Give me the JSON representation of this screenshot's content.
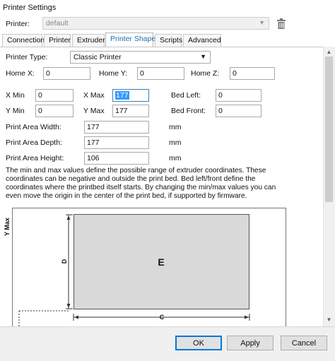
{
  "window": {
    "title": "Printer Settings"
  },
  "printer": {
    "label": "Printer:",
    "value": "default"
  },
  "tabs": [
    {
      "label": "Connection"
    },
    {
      "label": "Printer"
    },
    {
      "label": "Extruder"
    },
    {
      "label": "Printer Shape",
      "active": true
    },
    {
      "label": "Scripts"
    },
    {
      "label": "Advanced"
    }
  ],
  "printer_type": {
    "label": "Printer Type:",
    "value": "Classic Printer"
  },
  "home": {
    "x_label": "Home X:",
    "x_value": "0",
    "y_label": "Home Y:",
    "y_value": "0",
    "z_label": "Home Z:",
    "z_value": "0"
  },
  "range": {
    "x_min_label": "X Min",
    "x_min": "0",
    "x_max_label": "X Max",
    "x_max": "177",
    "bed_left_label": "Bed Left:",
    "bed_left": "0",
    "y_min_label": "Y Min",
    "y_min": "0",
    "y_max_label": "Y Max",
    "y_max": "177",
    "bed_front_label": "Bed Front:",
    "bed_front": "0"
  },
  "print_area": {
    "width_label": "Print Area Width:",
    "width": "177",
    "width_unit": "mm",
    "depth_label": "Print Area Depth:",
    "depth": "177",
    "depth_unit": "mm",
    "height_label": "Print Area Height:",
    "height": "106",
    "height_unit": "mm"
  },
  "description": "The min and max values define the possible range of extruder coordinates. These coordinates can be negative and outside the print bed. Bed left/front define the coordinates where the printbed itself starts. By changing the min/max values you can even move the origin in the center of the print bed, if supported by firmware.",
  "diagram": {
    "y_axis_label": "Y Max",
    "bed_label": "E",
    "depth_dim_label": "D",
    "width_dim_label": "C",
    "bed_fill": "#d9d9d9"
  },
  "buttons": {
    "ok": "OK",
    "apply": "Apply",
    "cancel": "Cancel"
  },
  "colors": {
    "accent": "#1b6fb3",
    "selection": "#3399ff",
    "default_button_border": "#0078d7"
  }
}
